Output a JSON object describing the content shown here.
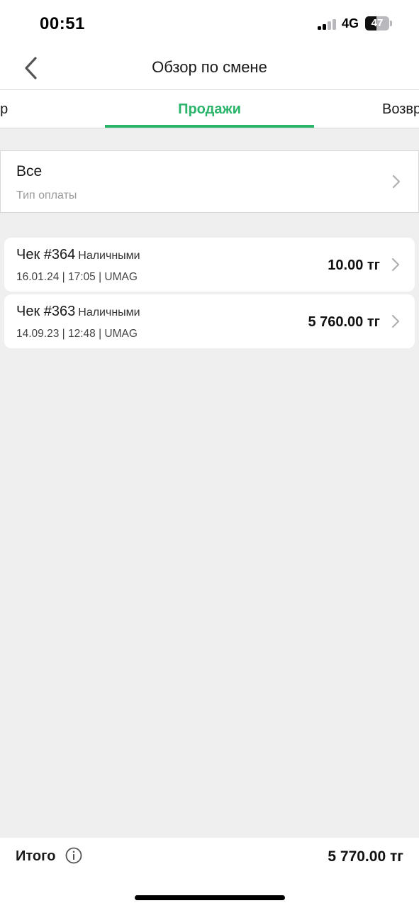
{
  "status_bar": {
    "time": "00:51",
    "network": "4G",
    "battery_level": "47",
    "battery_fraction": 0.47,
    "signal_bars_active": 2,
    "signal_bars_total": 4
  },
  "nav": {
    "title": "Обзор по смене",
    "back_icon": "chevron-left-icon"
  },
  "tabs": [
    {
      "label": "зор",
      "active": false
    },
    {
      "label": "Продажи",
      "active": true
    },
    {
      "label": "Возвр",
      "active": false
    }
  ],
  "filter": {
    "value": "Все",
    "label": "Тип оплаты"
  },
  "receipts": [
    {
      "title": "Чек #364",
      "payment": "Наличными",
      "meta": "16.01.24 | 17:05 | UMAG",
      "amount": "10.00 тг"
    },
    {
      "title": "Чек #363",
      "payment": "Наличными",
      "meta": "14.09.23 | 12:48 | UMAG",
      "amount": "5 760.00 тг"
    }
  ],
  "footer": {
    "total_label": "Итого",
    "total_value": "5 770.00 тг",
    "info_icon": "info-icon"
  },
  "colors": {
    "accent": "#2ab56b",
    "background": "#efefef",
    "card": "#ffffff",
    "muted_text": "#9a9a9a"
  }
}
